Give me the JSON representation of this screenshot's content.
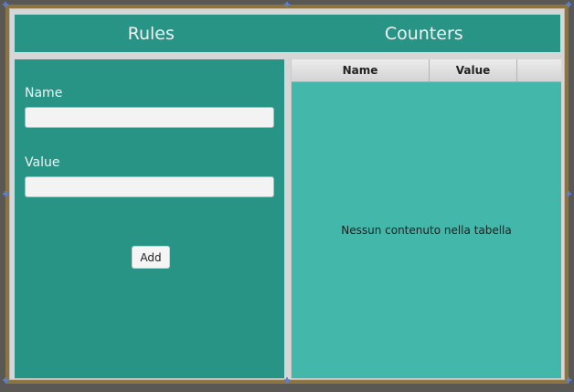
{
  "tabs": [
    {
      "label": "Rules"
    },
    {
      "label": "Counters"
    }
  ],
  "form": {
    "name_label": "Name",
    "name_value": "",
    "value_label": "Value",
    "value_value": "",
    "add_button_label": "Add"
  },
  "table": {
    "columns": [
      "Name",
      "Value"
    ],
    "empty_message": "Nessun contenuto nella tabella"
  },
  "colors": {
    "panel_dark": "#279486",
    "panel_light": "#43b7aa",
    "frame": "#8c7442"
  }
}
